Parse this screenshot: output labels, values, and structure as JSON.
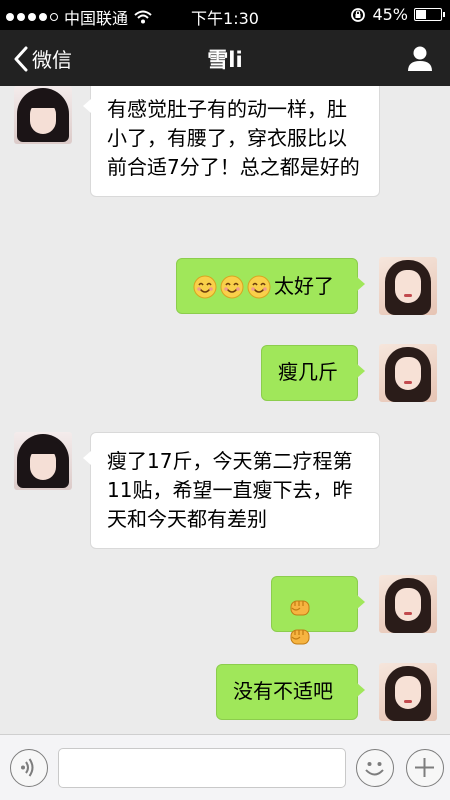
{
  "status_bar": {
    "carrier": "中国联通",
    "time": "下午1:30",
    "battery": "45%",
    "battery_level": 0.45,
    "icons": [
      "signal-dots-icon",
      "wifi-icon",
      "rotation-lock-icon",
      "battery-icon"
    ]
  },
  "nav": {
    "back_label": "微信",
    "title": "雪li",
    "icons": [
      "chevron-left-icon",
      "profile-icon"
    ]
  },
  "messages": [
    {
      "side": "in",
      "text": "有感觉肚子有的动一样，肚小了，有腰了，穿衣服比以前合适7分了！总之都是好的"
    },
    {
      "side": "out",
      "emoji_count": 3,
      "emoji": "smile-emoji",
      "text": "太好了"
    },
    {
      "side": "out",
      "text": "瘦几斤"
    },
    {
      "side": "in",
      "text": "瘦了17斤，今天第二疗程第11贴，希望一直瘦下去，昨天和今天都有差别"
    },
    {
      "side": "out",
      "emoji_count": 2,
      "emoji": "fist-emoji",
      "text": ""
    },
    {
      "side": "out",
      "text": "没有不适吧"
    }
  ],
  "input_bar": {
    "icons": [
      "voice-icon",
      "emoji-icon",
      "plus-icon"
    ],
    "text_value": ""
  },
  "colors": {
    "outgoing_bubble": "#a0e75a",
    "incoming_bubble": "#ffffff",
    "nav_background": "#222222",
    "chat_background": "#ebebeb"
  }
}
